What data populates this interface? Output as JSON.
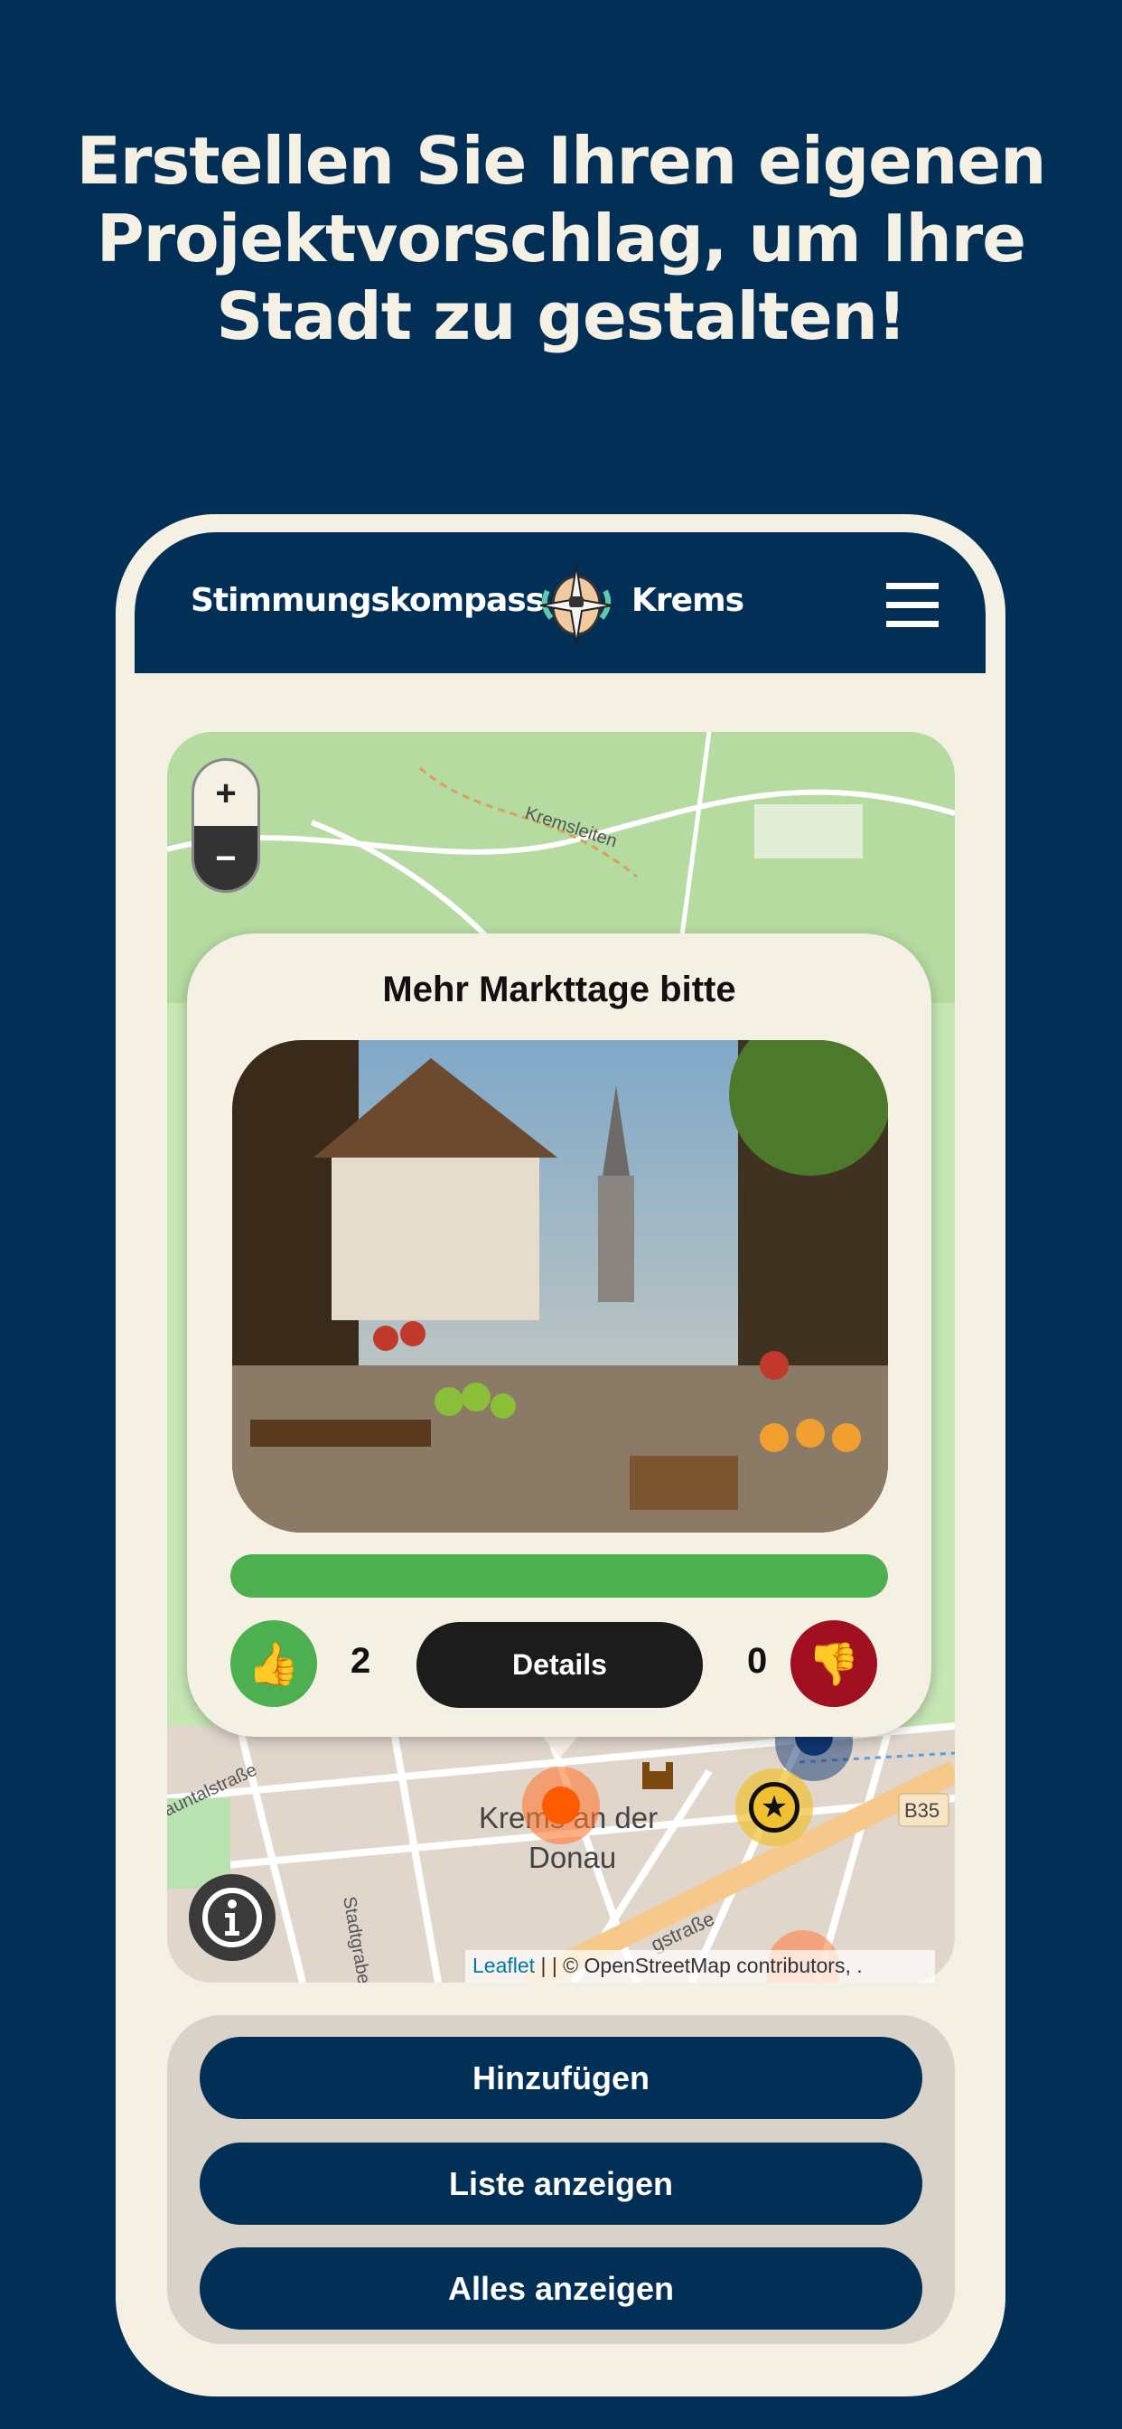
{
  "headline": "Erstellen Sie Ihren eigenen Projektvorschlag, um Ihre Stadt zu gestalten!",
  "app_bar": {
    "brand_left": "Stimmungskompass",
    "brand_right": "Krems",
    "logo_icon": "compass-logo-icon",
    "menu_icon": "hamburger-menu-icon"
  },
  "map": {
    "zoom_in": "+",
    "zoom_out": "−",
    "labels": {
      "street1": "Kremsleiten",
      "place": "Krems an der",
      "place2": "Donau",
      "road": "B35",
      "street2": "Stadtgraben",
      "street3": "auntalstraße",
      "street4": "gstraße"
    },
    "attribution": {
      "link": "Leaflet",
      "text": " | | © OpenStreetMap contributors, ."
    },
    "marker_colors": {
      "selected": "#ff5a00",
      "star": "#f0c030",
      "blue": "#0e3470"
    }
  },
  "popup": {
    "title": "Mehr Markttage bitte",
    "approval_percent": 100,
    "likes": "2",
    "dislikes": "0",
    "details_label": "Details",
    "like_icon": "thumbs-up-icon",
    "dislike_icon": "thumbs-down-icon",
    "colors": {
      "like": "#4caf50",
      "dislike": "#a01020",
      "bar": "#4caf50"
    }
  },
  "actions": {
    "add": "Hinzufügen",
    "list": "Liste anzeigen",
    "all": "Alles anzeigen"
  }
}
